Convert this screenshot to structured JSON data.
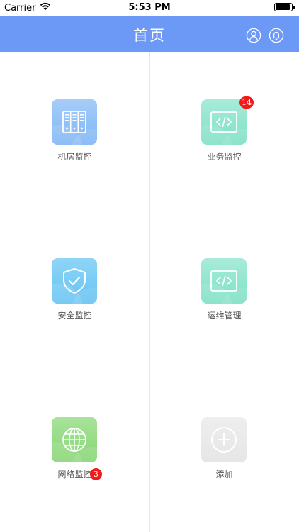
{
  "status_bar": {
    "carrier": "Carrier",
    "time": "5:53 PM",
    "battery_level": 0.92
  },
  "nav": {
    "title": "首页",
    "user_icon": "user-icon",
    "bell_icon": "bell-icon"
  },
  "modules": [
    {
      "label": "机房监控",
      "icon": "server-rack-icon",
      "badge": "",
      "color_top": "#a6cdf8",
      "color_bottom": "#7fb6f4"
    },
    {
      "label": "业务监控",
      "icon": "code-icon",
      "badge": "14",
      "color_top": "#a8ecd9",
      "color_bottom": "#7de0c4"
    },
    {
      "label": "安全监控",
      "icon": "shield-check-icon",
      "badge": "",
      "color_top": "#8fd5f7",
      "color_bottom": "#66c3f2"
    },
    {
      "label": "运维管理",
      "icon": "code-icon",
      "badge": "",
      "color_top": "#a8ecd9",
      "color_bottom": "#7de0c4"
    },
    {
      "label": "网络监控",
      "icon": "globe-icon",
      "badge": "3",
      "color_top": "#a8e39a",
      "color_bottom": "#86d673"
    },
    {
      "label": "添加",
      "icon": "plus-circle-icon",
      "badge": "",
      "color_top": "#eeeeee",
      "color_bottom": "#e6e6e6"
    }
  ],
  "colors": {
    "nav_bg": "#6b99f5",
    "badge_bg": "#f21a1a",
    "divider": "#e6e6e6"
  }
}
